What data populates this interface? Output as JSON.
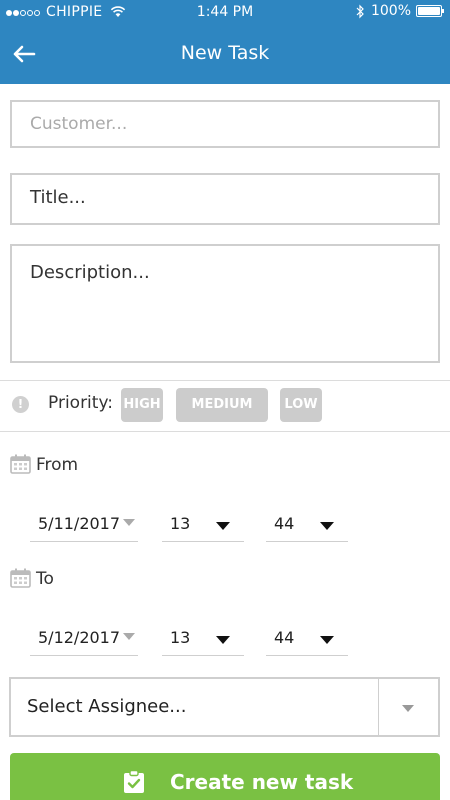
{
  "status_bar": {
    "carrier": "CHIPPIE",
    "time": "1:44 PM",
    "battery": "100%",
    "signal_bars_filled": 2,
    "signal_bars_total": 5
  },
  "header": {
    "title": "New Task",
    "back_icon": "back-arrow-icon"
  },
  "form": {
    "customer_placeholder": "Customer...",
    "title_placeholder": "Title...",
    "description_placeholder": "Description..."
  },
  "priority": {
    "label": "Priority:",
    "options": [
      "HIGH",
      "MEDIUM",
      "LOW"
    ]
  },
  "from": {
    "label": "From",
    "date": "5/11/2017",
    "hour": "13",
    "minute": "44"
  },
  "to": {
    "label": "To",
    "date": "5/12/2017",
    "hour": "13",
    "minute": "44"
  },
  "assignee": {
    "placeholder": "Select Assignee..."
  },
  "create_button": {
    "label": "Create new task"
  },
  "colors": {
    "header": "#2e86c1",
    "create_button": "#7ac143",
    "priority_inactive": "#cccccc"
  }
}
